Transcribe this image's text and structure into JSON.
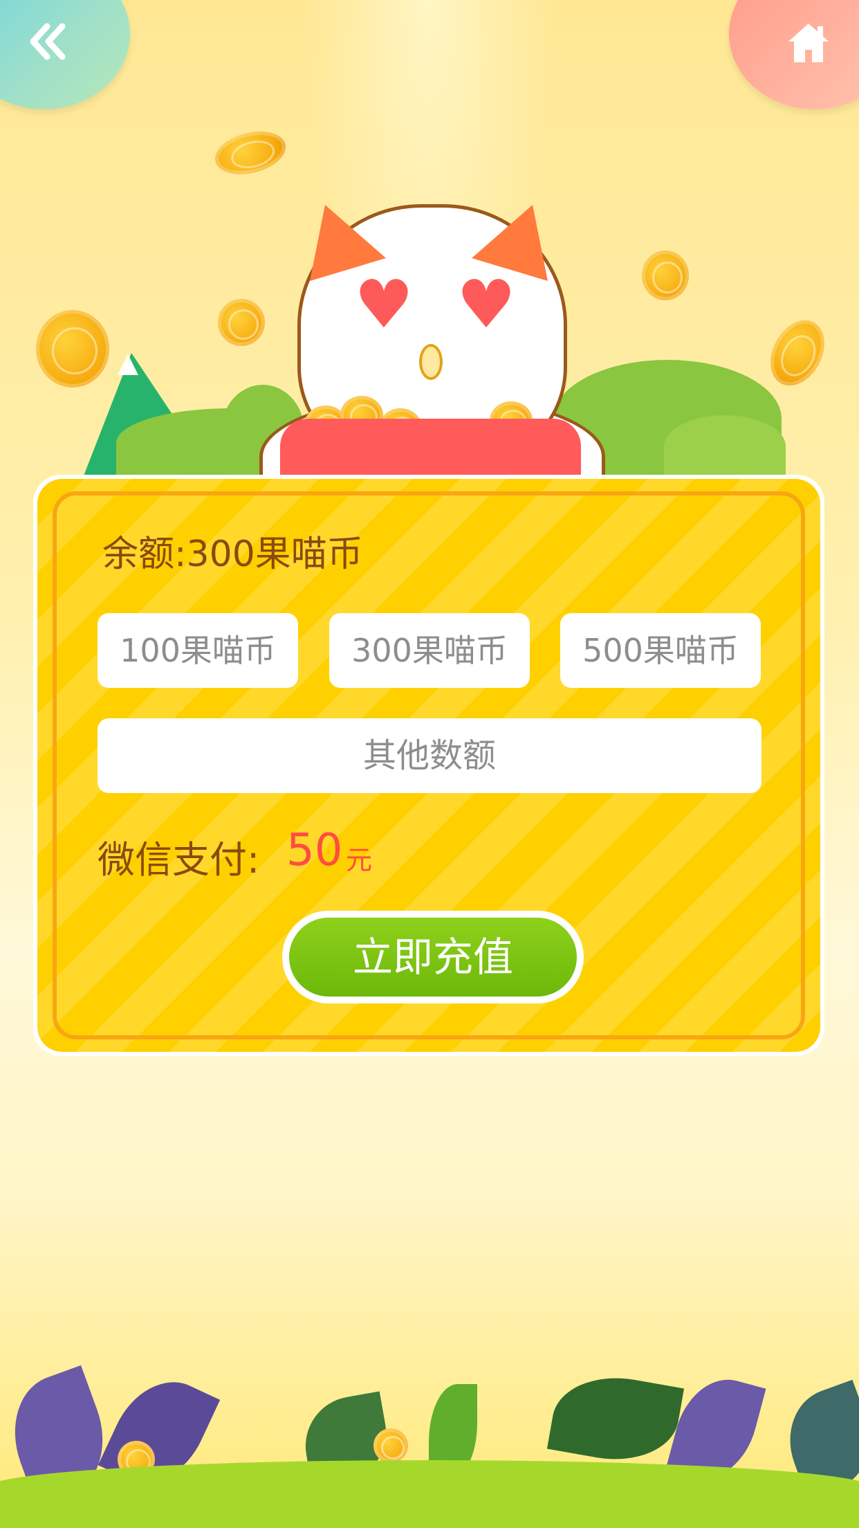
{
  "nav": {
    "back_icon": "double-chevron-left-icon",
    "home_icon": "home-icon"
  },
  "balance": {
    "label": "余额:",
    "value": "300果喵币"
  },
  "options": [
    {
      "label": "100果喵币"
    },
    {
      "label": "300果喵币"
    },
    {
      "label": "500果喵币"
    }
  ],
  "other_amount": {
    "label": "其他数额"
  },
  "payment": {
    "label": "微信支付:",
    "amount": "50",
    "unit": "元"
  },
  "submit": {
    "label": "立即充值"
  },
  "colors": {
    "card": "#ffd000",
    "button": "#7cc511",
    "price": "#ff4d3f",
    "text": "#8a4a0d"
  }
}
